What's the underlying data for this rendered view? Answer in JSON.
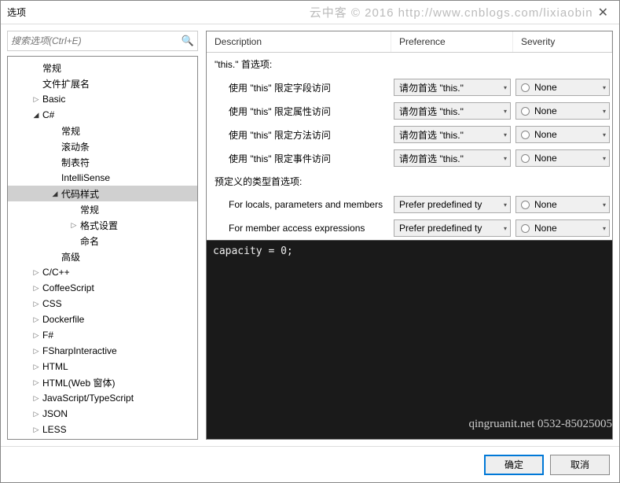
{
  "title": "选项",
  "watermark": "云中客 © 2016 http://www.cnblogs.com/lixiaobin",
  "search": {
    "placeholder": "搜索选项(Ctrl+E)"
  },
  "tree": [
    {
      "label": "常规",
      "indent": 2,
      "exp": ""
    },
    {
      "label": "文件扩展名",
      "indent": 2,
      "exp": ""
    },
    {
      "label": "Basic",
      "indent": 2,
      "exp": "▷"
    },
    {
      "label": "C#",
      "indent": 2,
      "exp": "◢"
    },
    {
      "label": "常规",
      "indent": 4,
      "exp": ""
    },
    {
      "label": "滚动条",
      "indent": 4,
      "exp": ""
    },
    {
      "label": "制表符",
      "indent": 4,
      "exp": ""
    },
    {
      "label": "IntelliSense",
      "indent": 4,
      "exp": ""
    },
    {
      "label": "代码样式",
      "indent": 4,
      "exp": "◢",
      "selected": true
    },
    {
      "label": "常规",
      "indent": 6,
      "exp": ""
    },
    {
      "label": "格式设置",
      "indent": 6,
      "exp": "▷"
    },
    {
      "label": "命名",
      "indent": 6,
      "exp": ""
    },
    {
      "label": "高级",
      "indent": 4,
      "exp": ""
    },
    {
      "label": "C/C++",
      "indent": 2,
      "exp": "▷"
    },
    {
      "label": "CoffeeScript",
      "indent": 2,
      "exp": "▷"
    },
    {
      "label": "CSS",
      "indent": 2,
      "exp": "▷"
    },
    {
      "label": "Dockerfile",
      "indent": 2,
      "exp": "▷"
    },
    {
      "label": "F#",
      "indent": 2,
      "exp": "▷"
    },
    {
      "label": "FSharpInteractive",
      "indent": 2,
      "exp": "▷"
    },
    {
      "label": "HTML",
      "indent": 2,
      "exp": "▷"
    },
    {
      "label": "HTML(Web 窗体)",
      "indent": 2,
      "exp": "▷"
    },
    {
      "label": "JavaScript/TypeScript",
      "indent": 2,
      "exp": "▷"
    },
    {
      "label": "JSON",
      "indent": 2,
      "exp": "▷"
    },
    {
      "label": "LESS",
      "indent": 2,
      "exp": "▷"
    }
  ],
  "columns": {
    "desc": "Description",
    "pref": "Preference",
    "sev": "Severity"
  },
  "groups": [
    {
      "title": "\"this.\" 首选项:",
      "rows": [
        {
          "desc": "使用 \"this\" 限定字段访问",
          "pref": "请勿首选 \"this.\"",
          "sev": "None"
        },
        {
          "desc": "使用 \"this\" 限定属性访问",
          "pref": "请勿首选 \"this.\"",
          "sev": "None"
        },
        {
          "desc": "使用 \"this\" 限定方法访问",
          "pref": "请勿首选 \"this.\"",
          "sev": "None"
        },
        {
          "desc": "使用 \"this\" 限定事件访问",
          "pref": "请勿首选 \"this.\"",
          "sev": "None"
        }
      ]
    },
    {
      "title": "预定义的类型首选项:",
      "rows": [
        {
          "desc": "For locals, parameters and members",
          "pref": "Prefer predefined ty",
          "sev": "None"
        },
        {
          "desc": "For member access expressions",
          "pref": "Prefer predefined ty",
          "sev": "None"
        }
      ]
    }
  ],
  "preview": {
    "code": "capacity = 0;",
    "watermark": "qingruanit.net 0532-85025005"
  },
  "buttons": {
    "ok": "确定",
    "cancel": "取消"
  }
}
